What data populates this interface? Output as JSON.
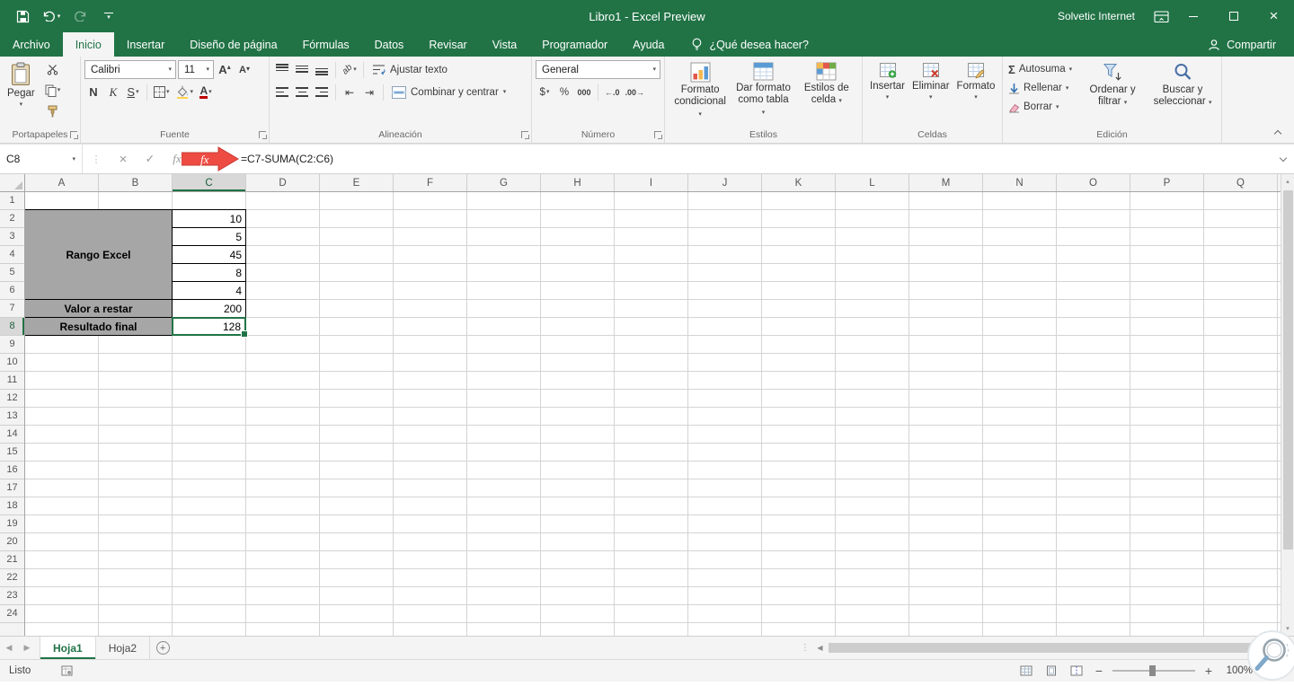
{
  "window": {
    "title": "Libro1 - Excel Preview",
    "account": "Solvetic Internet"
  },
  "tabs": {
    "items": [
      {
        "label": "Archivo",
        "file": true
      },
      {
        "label": "Inicio",
        "active": true
      },
      {
        "label": "Insertar"
      },
      {
        "label": "Diseño de página"
      },
      {
        "label": "Fórmulas"
      },
      {
        "label": "Datos"
      },
      {
        "label": "Revisar"
      },
      {
        "label": "Vista"
      },
      {
        "label": "Programador"
      },
      {
        "label": "Ayuda"
      }
    ],
    "tell_me": "¿Qué desea hacer?",
    "share": "Compartir"
  },
  "ribbon": {
    "clipboard": {
      "label": "Portapapeles",
      "paste": "Pegar"
    },
    "font": {
      "label": "Fuente",
      "family": "Calibri",
      "size": "11",
      "bold": "N",
      "italic": "K",
      "underline": "S"
    },
    "alignment": {
      "label": "Alineación",
      "wrap": "Ajustar texto",
      "merge": "Combinar y centrar"
    },
    "number": {
      "label": "Número",
      "format": "General",
      "currency": "$",
      "percent": "%",
      "thousands": "000"
    },
    "styles": {
      "label": "Estilos",
      "conditional": "Formato condicional",
      "as_table": "Dar formato como tabla",
      "cell_styles": "Estilos de celda"
    },
    "cells": {
      "label": "Celdas",
      "insert": "Insertar",
      "delete": "Eliminar",
      "format": "Formato"
    },
    "editing": {
      "label": "Edición",
      "autosum": "Autosuma",
      "fill": "Rellenar",
      "clear": "Borrar",
      "sort": "Ordenar y filtrar",
      "find": "Buscar y seleccionar"
    }
  },
  "formula_bar": {
    "name_box": "C8",
    "formula": "=C7-SUMA(C2:C6)"
  },
  "grid": {
    "columns": [
      "A",
      "B",
      "C",
      "D",
      "E",
      "F",
      "G",
      "H",
      "I",
      "J",
      "K",
      "L",
      "M",
      "N",
      "O",
      "P",
      "Q"
    ],
    "row_count": 24,
    "active_cell": "C8",
    "selected_column": "C",
    "selected_row": 8,
    "labels": [
      {
        "text": "Rango Excel",
        "col_start": 0,
        "col_span": 2,
        "row_start": 2,
        "row_end": 6
      },
      {
        "text": "Valor a restar",
        "col_start": 0,
        "col_span": 2,
        "row_start": 7,
        "row_end": 7
      },
      {
        "text": "Resultado final",
        "col_start": 0,
        "col_span": 2,
        "row_start": 8,
        "row_end": 8
      }
    ],
    "values": {
      "C2": "10",
      "C3": "5",
      "C4": "45",
      "C5": "8",
      "C6": "4",
      "C7": "200",
      "C8": "128"
    }
  },
  "sheets": {
    "items": [
      {
        "label": "Hoja1",
        "active": true
      },
      {
        "label": "Hoja2"
      }
    ]
  },
  "status": {
    "mode": "Listo",
    "zoom": "100%"
  },
  "colors": {
    "accent": "#217346",
    "cell_fill": "#a6a6a6",
    "annotation_arrow": "#ee4c43",
    "selection": "#217346"
  }
}
